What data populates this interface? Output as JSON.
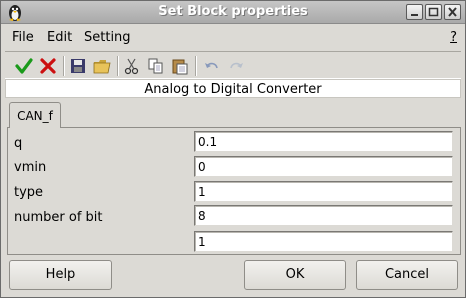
{
  "window": {
    "title": "Set Block properties"
  },
  "menu": {
    "file": "File",
    "edit": "Edit",
    "setting": "Setting",
    "help": "?"
  },
  "toolbar": {
    "items": [
      "ok-check-icon",
      "cancel-x-icon",
      "save-icon",
      "open-folder-icon",
      "cut-icon",
      "copy-icon",
      "paste-icon",
      "undo-icon",
      "redo-icon"
    ]
  },
  "subtitle": "Analog to Digital Converter",
  "tab": {
    "label": "CAN_f"
  },
  "params": [
    {
      "label": "q",
      "value": "0.1"
    },
    {
      "label": "vmin",
      "value": "0"
    },
    {
      "label": "type",
      "value": "1"
    },
    {
      "label": "number of bit",
      "value": "8"
    },
    {
      "label": "",
      "value": "1"
    }
  ],
  "buttons": {
    "help": "Help",
    "ok": "OK",
    "cancel": "Cancel"
  },
  "colors": {
    "accept": "#1a9a1a",
    "reject": "#cc1010",
    "title_bg": "#b8b8b8"
  }
}
